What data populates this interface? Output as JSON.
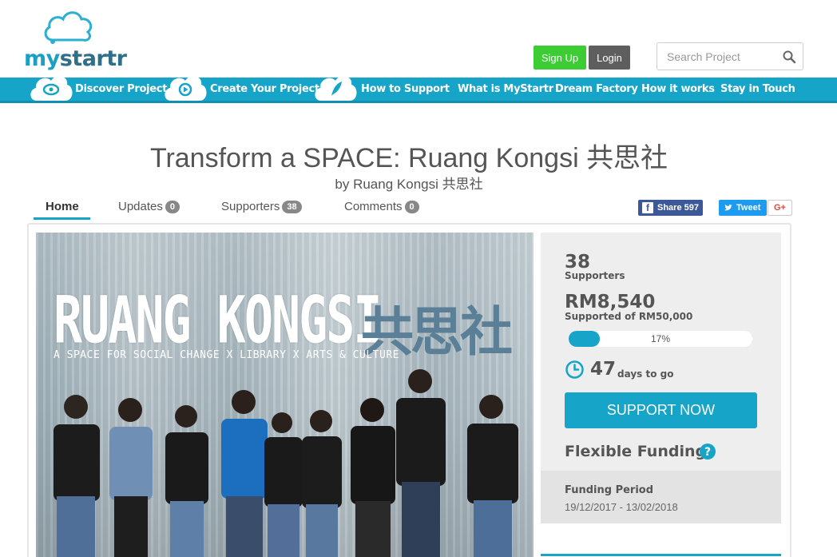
{
  "header": {
    "logo": {
      "part1": "my",
      "part2": "startr"
    },
    "signup_label": "Sign Up",
    "login_label": "Login",
    "search": {
      "placeholder": "Search Project",
      "icon": "search-icon"
    }
  },
  "nav": {
    "items": [
      {
        "label": "Discover Project",
        "icon": "eye-icon"
      },
      {
        "label": "Create Your Project",
        "icon": "play-icon"
      },
      {
        "label": "How to Support",
        "icon": "feather-icon"
      },
      {
        "label": "What is MyStartr"
      },
      {
        "label": "Dream Factory"
      },
      {
        "label": "How it works"
      },
      {
        "label": "Stay in Touch"
      }
    ]
  },
  "project": {
    "title": "Transform a SPACE: Ruang Kongsi 共思社",
    "by_prefix": "by",
    "creator": "Ruang Kongsi 共思社"
  },
  "tabs": [
    {
      "label": "Home"
    },
    {
      "label": "Updates",
      "count": "0"
    },
    {
      "label": "Supporters",
      "count": "38"
    },
    {
      "label": "Comments",
      "count": "0"
    }
  ],
  "social": {
    "share_label": "Share",
    "share_count": "597",
    "tweet_label": "Tweet",
    "gplus_label": "G+"
  },
  "hero": {
    "title": "RUANG KONGSI",
    "chinese": "共思社",
    "tagline": "A SPACE FOR SOCIAL CHANGE X LIBRARY X ARTS & CULTURE"
  },
  "stats": {
    "supporters_count": "38",
    "supporters_label": "Supporters",
    "amount": "RM8,540",
    "goal_label": "Supported of RM50,000",
    "progress_percent": 17,
    "progress_label": "17%",
    "days_left": "47",
    "days_label": "days to go",
    "support_button": "SUPPORT NOW",
    "funding_type": "Flexible Funding",
    "period_label": "Funding Period",
    "period_value": "19/12/2017 - 13/02/2018"
  },
  "colors": {
    "brand": "#16a4c9",
    "signup": "#3ccc33",
    "login": "#5e5e5e",
    "facebook": "#3b5998",
    "twitter": "#1d9bf0"
  }
}
